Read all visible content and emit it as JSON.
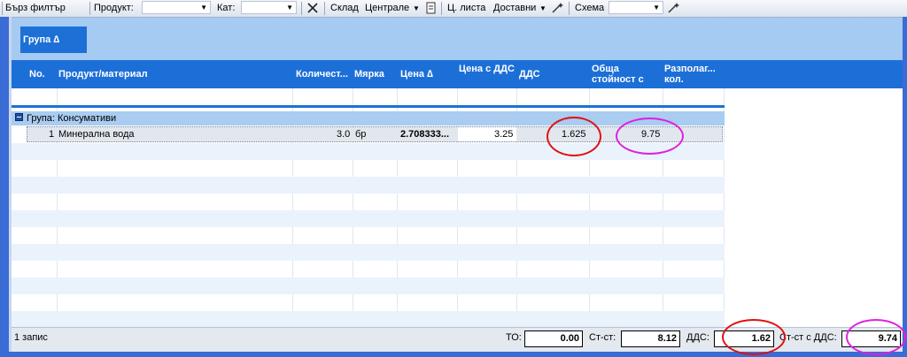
{
  "toolbar": {
    "quick_filter": "Бърз филтър",
    "product_label": "Продукт:",
    "product_value": "",
    "category_label": "Кат:",
    "category_value": "",
    "warehouse_label": "Склад",
    "warehouse_value": "Централе",
    "price_list_label": "Ц. листа",
    "price_list_value": "Доставни",
    "scheme_label": "Схема",
    "scheme_value": ""
  },
  "group_by": {
    "chip_label": "Група ∆"
  },
  "columns": [
    "No.",
    "Продукт/материал",
    "Количест...",
    "Мярка",
    "Цена ∆",
    "Цена с ДДС",
    "ДДС",
    "Обща стойност с",
    "Разполаг... кол."
  ],
  "group_row": {
    "label": "Група: Консумативи"
  },
  "rows": [
    {
      "no": "1",
      "product": "Минерална вода",
      "quantity": "3.0",
      "unit": "бр",
      "price": "2.708333...",
      "price_vat": "3.25",
      "vat": "1.625",
      "total": "9.75",
      "available": ""
    }
  ],
  "footer": {
    "records": "1 запис",
    "to_label": "ТО:",
    "to_value": "0.00",
    "cost_label": "Ст-ст:",
    "cost_value": "8.12",
    "vat_label": "ДДС:",
    "vat_value": "1.62",
    "cost_vat_label": "Ст-ст с ДДС:",
    "cost_vat_value": "9.74"
  },
  "annotation_colors": {
    "red": "#e01010",
    "magenta": "#e020e0"
  }
}
